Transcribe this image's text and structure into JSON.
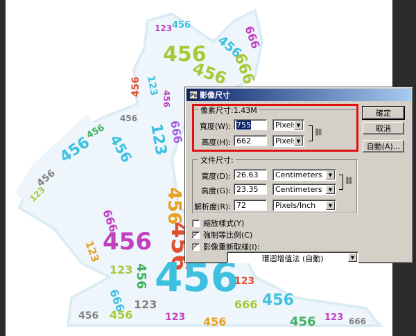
{
  "dialog": {
    "title": "影像尺寸",
    "title_icon": "photoshop-icon",
    "pixel_group": {
      "label": "像素尺寸:1.43M",
      "width_label": "寬度(W):",
      "width_value": "755",
      "width_unit": "Pixels",
      "height_label": "高度(H):",
      "height_value": "662",
      "height_unit": "Pixels"
    },
    "doc_group": {
      "label": "文件尺寸:",
      "width_label": "寬度(D):",
      "width_value": "26.63",
      "width_unit": "Centimeters",
      "height_label": "高度(G):",
      "height_value": "23.35",
      "height_unit": "Centimeters",
      "res_label": "解析度(R):",
      "res_value": "72",
      "res_unit": "Pixels/Inch"
    },
    "buttons": {
      "ok": "確定",
      "cancel": "取消",
      "auto": "自動(A)..."
    },
    "options": {
      "scale_styles": "縮放樣式(Y)",
      "constrain": "強制等比例(C)",
      "resample": "影像重新取樣(I):",
      "resample_method": "環迴增值法 (自動)"
    }
  },
  "canvas": {
    "words": [
      "456",
      "123",
      "666"
    ],
    "colors": [
      "#3ec0e0",
      "#a8c838",
      "#e05030",
      "#c040c0",
      "#808080",
      "#40b060",
      "#a060e0",
      "#e8a020"
    ]
  }
}
